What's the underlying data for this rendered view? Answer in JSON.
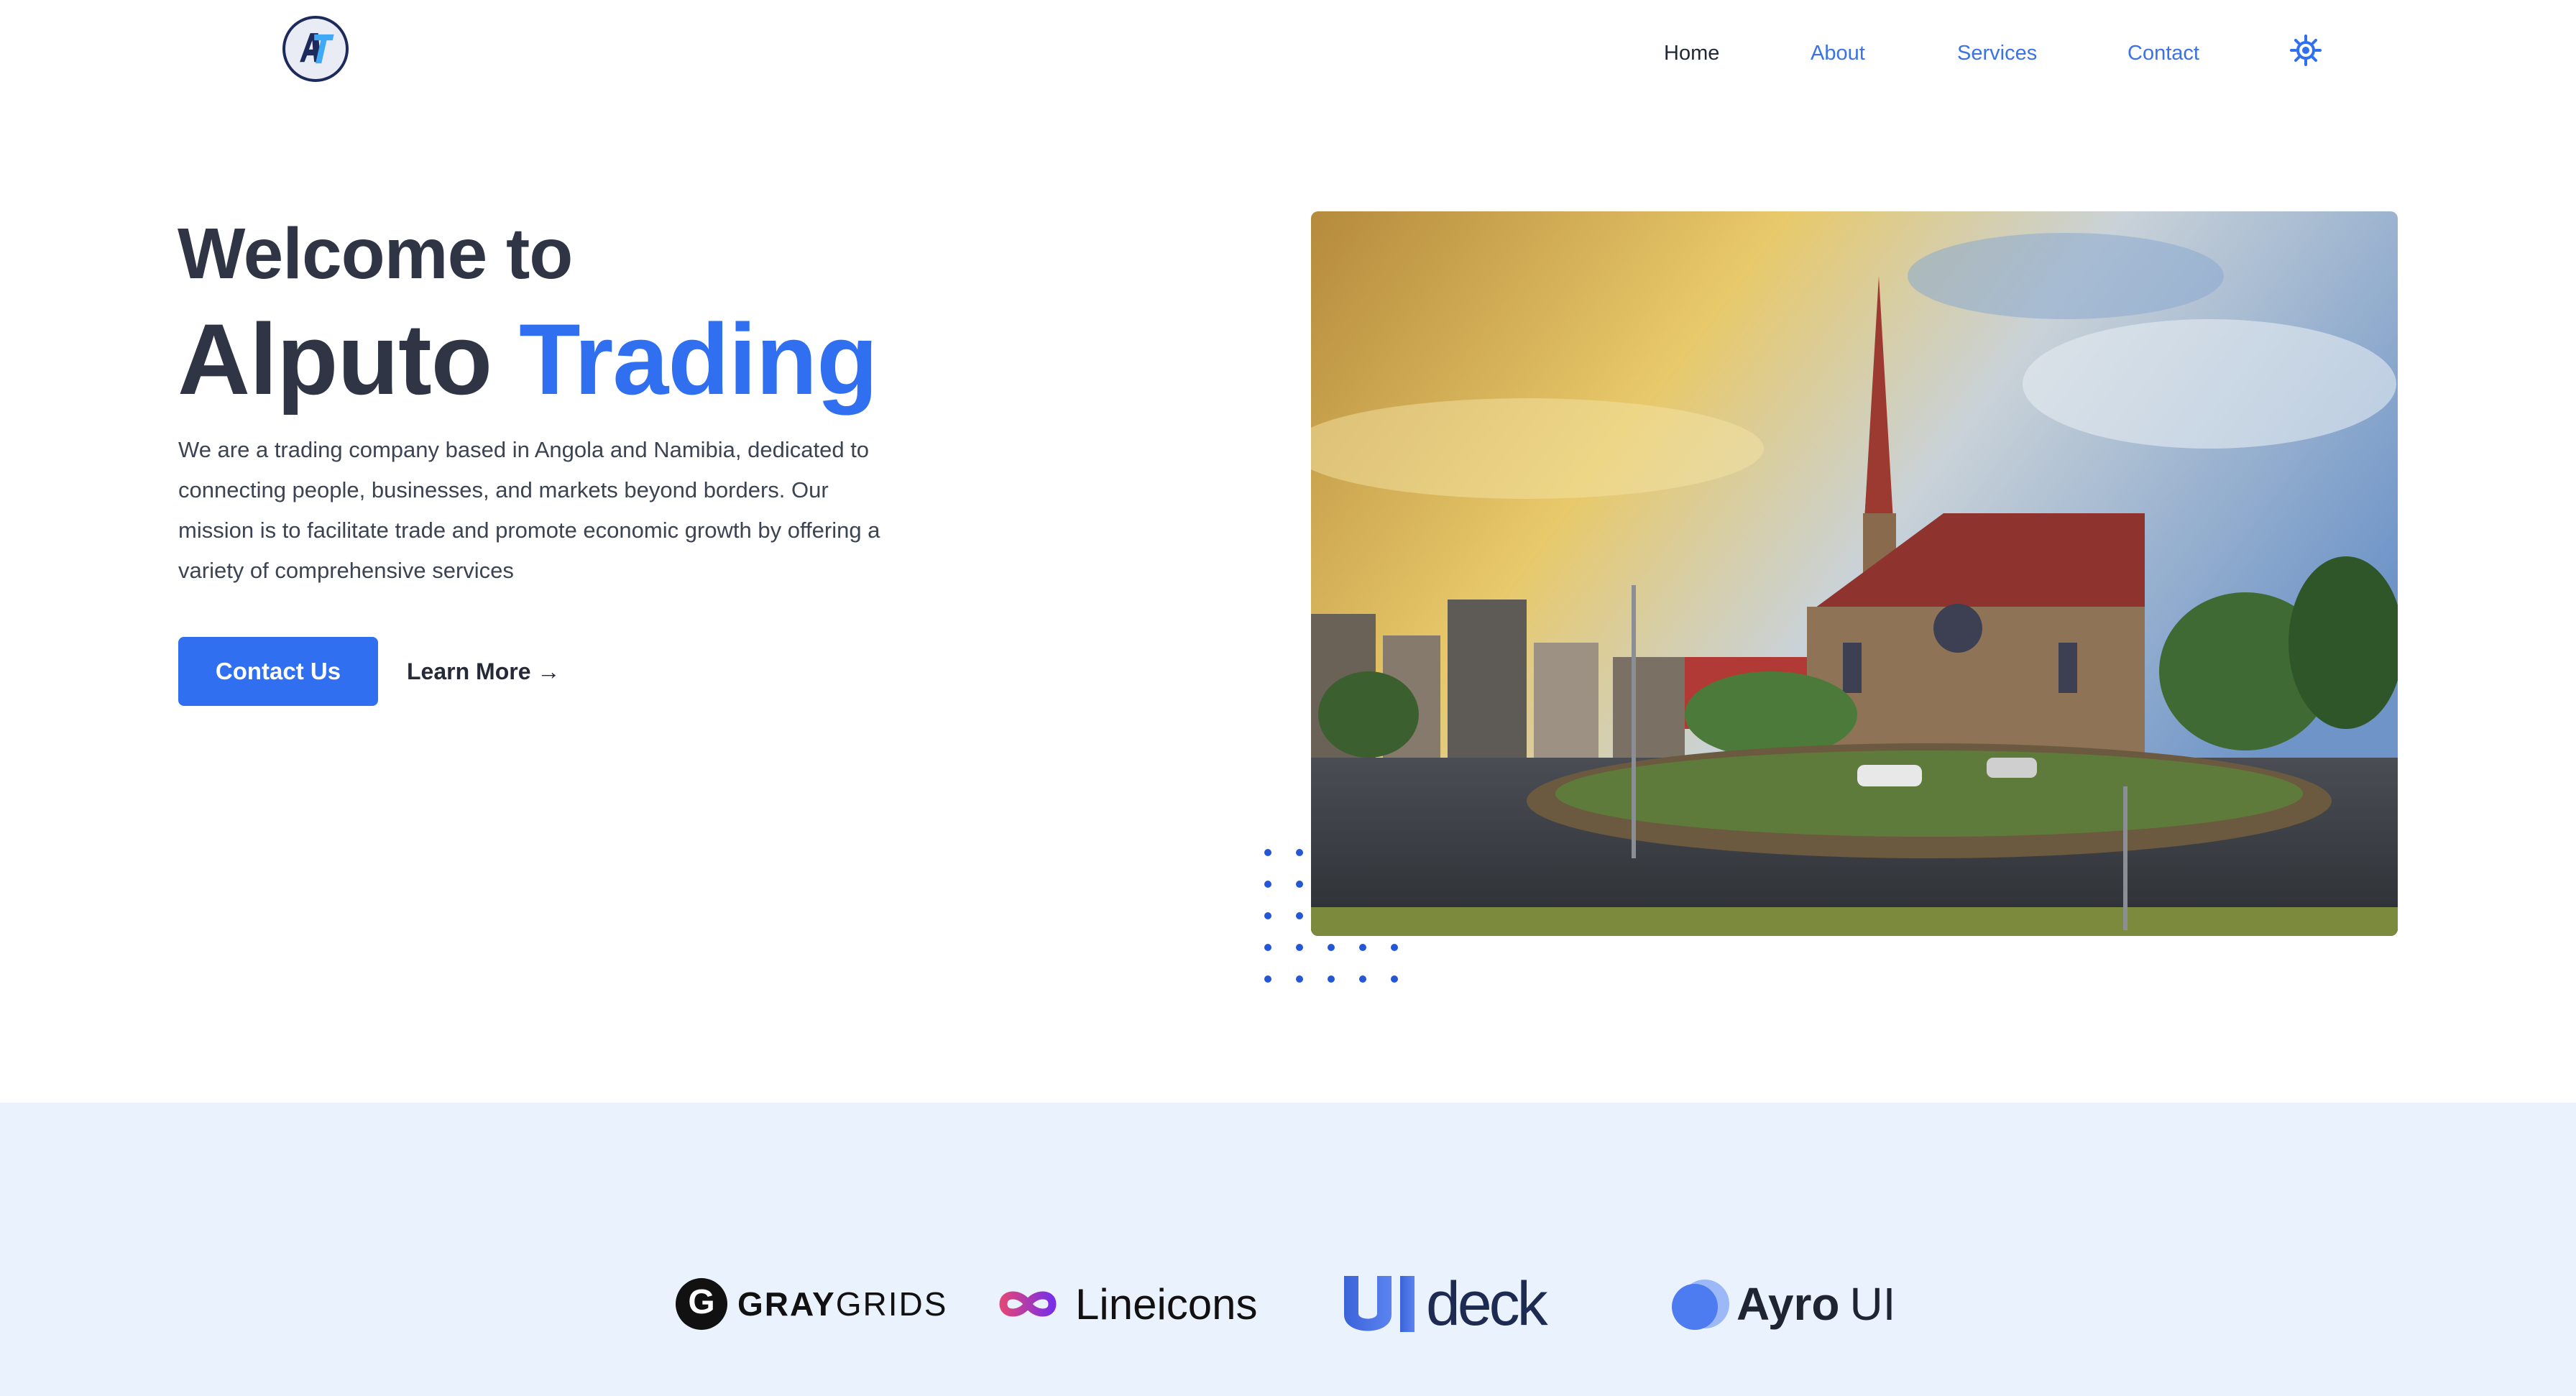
{
  "header": {
    "logo_letters": "AT",
    "nav": {
      "home": "Home",
      "about": "About",
      "services": "Services",
      "contact": "Contact"
    },
    "theme_toggle_icon": "sun-icon"
  },
  "hero": {
    "heading_line1": "Welcome to",
    "heading_name": "Alputo",
    "heading_accent": "Trading",
    "description": "We are a trading company based in Angola and Namibia, dedicated to connecting people, businesses, and markets beyond borders. Our mission is to facilitate trade and promote economic growth by offering a variety of comprehensive services",
    "primary_button": "Contact Us",
    "secondary_link": "Learn More →",
    "image_subject": "church-cityscape-photo"
  },
  "brands": {
    "graygrids": {
      "strong": "GRAY",
      "light": "GRIDS"
    },
    "lineicons": "Lineicons",
    "uideck": "deck",
    "ayro": {
      "strong": "Ayro",
      "light": "UI"
    }
  },
  "colors": {
    "accent": "#2f6ff0",
    "heading": "#2f3545",
    "body_text": "#3c4352",
    "brand_strip_bg": "#eaf2fd",
    "dots": "#2456d6"
  }
}
